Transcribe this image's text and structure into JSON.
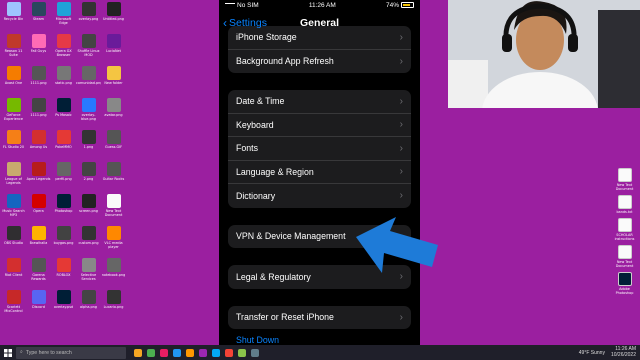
{
  "desktop": {
    "icons": [
      {
        "label": "Recycle Bin",
        "color": "#9ec5ff"
      },
      {
        "label": "Steam",
        "color": "#2a475e"
      },
      {
        "label": "Microsoft Edge",
        "color": "#1fa2d8"
      },
      {
        "label": "overlay.png",
        "color": "#333"
      },
      {
        "label": "Untitled.png",
        "color": "#222"
      },
      {
        "label": "Reason 11 Suite",
        "color": "#c0392b"
      },
      {
        "label": "Fall Guys",
        "color": "#ff6bb5"
      },
      {
        "label": "Opera GX Browser",
        "color": "#e63946"
      },
      {
        "label": "Shuffle Linux MOD",
        "color": "#444"
      },
      {
        "label": "LuciaNet",
        "color": "#6a1b9a"
      },
      {
        "label": "Avast One",
        "color": "#f57c00"
      },
      {
        "label": "1111.png",
        "color": "#555"
      },
      {
        "label": "static.png",
        "color": "#777"
      },
      {
        "label": "comunidad.png",
        "color": "#666"
      },
      {
        "label": "New folder",
        "color": "#f4c542"
      },
      {
        "label": "GeForce Experience",
        "color": "#76b900"
      },
      {
        "label": "1111.png",
        "color": "#444"
      },
      {
        "label": "Ps Mosaic",
        "color": "#001e36"
      },
      {
        "label": "overlay-blue.png",
        "color": "#2979ff"
      },
      {
        "label": "avatar.png",
        "color": "#888"
      },
      {
        "label": "FL Studio 20",
        "color": "#f57f17"
      },
      {
        "label": "Among Us",
        "color": "#d32f2f"
      },
      {
        "label": "PokeMMO",
        "color": "#e53935"
      },
      {
        "label": "1.png",
        "color": "#333"
      },
      {
        "label": "Guess.GIF",
        "color": "#555"
      },
      {
        "label": "League of Legends",
        "color": "#c8aa6e"
      },
      {
        "label": "Apex Legends",
        "color": "#b71c1c"
      },
      {
        "label": "perfil.png",
        "color": "#666"
      },
      {
        "label": "2.png",
        "color": "#444"
      },
      {
        "label": "Guitar Rocks",
        "color": "#555"
      },
      {
        "label": "Music Search MP3",
        "color": "#1565c0"
      },
      {
        "label": "Opera",
        "color": "#d50000"
      },
      {
        "label": "Photoshop",
        "color": "#001e36"
      },
      {
        "label": "screen.png",
        "color": "#222"
      },
      {
        "label": "New Text Document",
        "color": "#fafafa"
      },
      {
        "label": "OBS Studio",
        "color": "#302e31"
      },
      {
        "label": "Brawlhalla",
        "color": "#ffb300"
      },
      {
        "label": "buygas.png",
        "color": "#424242"
      },
      {
        "label": "custom.png",
        "color": "#333"
      },
      {
        "label": "VLC media player",
        "color": "#ff8800"
      },
      {
        "label": "Riot Client",
        "color": "#d32f2f"
      },
      {
        "label": "Garena Rewards",
        "color": "#555"
      },
      {
        "label": "ROBLOX",
        "color": "#e53935"
      },
      {
        "label": "Selective Services",
        "color": "#888"
      },
      {
        "label": "notebook.png",
        "color": "#666"
      },
      {
        "label": "Scarlett MixControl",
        "color": "#c62828"
      },
      {
        "label": "Discord",
        "color": "#5865f2"
      },
      {
        "label": "overlay.psd",
        "color": "#001e36"
      },
      {
        "label": "alpha.png",
        "color": "#444"
      },
      {
        "label": "Lucario.png",
        "color": "#333"
      }
    ],
    "right_icons": [
      {
        "label": "New Text Document",
        "color": "#fafafa"
      },
      {
        "label": "bands.txt",
        "color": "#fafafa"
      },
      {
        "label": "SCHOLAR instructions",
        "color": "#fafafa"
      },
      {
        "label": "New Text Document",
        "color": "#fafafa"
      },
      {
        "label": "Adobe Photoshop",
        "color": "#001e36"
      }
    ]
  },
  "phone": {
    "status": {
      "carrier": "No SIM",
      "time": "11:26 AM",
      "battery": "74%"
    },
    "nav": {
      "back_label": "Settings",
      "title": "General"
    },
    "groups": [
      [
        {
          "label": "iPhone Storage"
        },
        {
          "label": "Background App Refresh"
        }
      ],
      [
        {
          "label": "Date & Time"
        },
        {
          "label": "Keyboard"
        },
        {
          "label": "Fonts"
        },
        {
          "label": "Language & Region"
        },
        {
          "label": "Dictionary"
        }
      ],
      [
        {
          "label": "VPN & Device Management"
        }
      ],
      [
        {
          "label": "Legal & Regulatory"
        }
      ],
      [
        {
          "label": "Transfer or Reset iPhone"
        }
      ]
    ],
    "shutdown_label": "Shut Down",
    "accent": "#0a84ff"
  },
  "taskbar": {
    "search_placeholder": "Type here to search",
    "weather": "49°F Sunny",
    "time": "11:26 AM",
    "date": "10/26/2022",
    "apps": [
      "#f5a623",
      "#4caf50",
      "#e91e63",
      "#2196f3",
      "#ff9800",
      "#9c27b0",
      "#03a9f4",
      "#f44336",
      "#8bc34a",
      "#607d8b"
    ]
  },
  "overlay": {
    "arrow_color": "#1e7bd8",
    "arrow_icon": "left-arrow-icon"
  }
}
